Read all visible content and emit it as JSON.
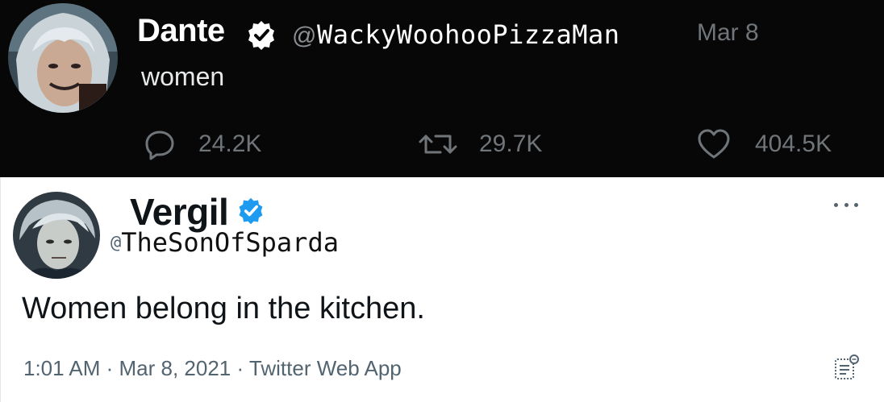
{
  "top_tweet": {
    "name": "Dante",
    "handle_at": "@",
    "handle": "WackyWoohooPizzaMan",
    "date": "Mar 8",
    "text": "women",
    "replies": "24.2K",
    "retweets": "29.7K",
    "likes": "404.5K"
  },
  "bottom_tweet": {
    "name": "Vergil",
    "handle_at": "@",
    "handle": "TheSonOfSparda",
    "text": "Women belong in the kitchen.",
    "time": "1:01 AM",
    "sep1": " · ",
    "date": "Mar 8, 2021",
    "sep2": " · ",
    "source": "Twitter Web App"
  },
  "icons": {
    "verified": "verified-badge-icon",
    "reply": "reply-icon",
    "retweet": "retweet-icon",
    "like": "heart-icon",
    "more": "more-icon",
    "analytics": "analytics-icon"
  },
  "colors": {
    "dark_bg": "#070707",
    "verified_dark": "#ffffff",
    "verified_light": "#1d9bf0",
    "muted": "#70757a"
  }
}
